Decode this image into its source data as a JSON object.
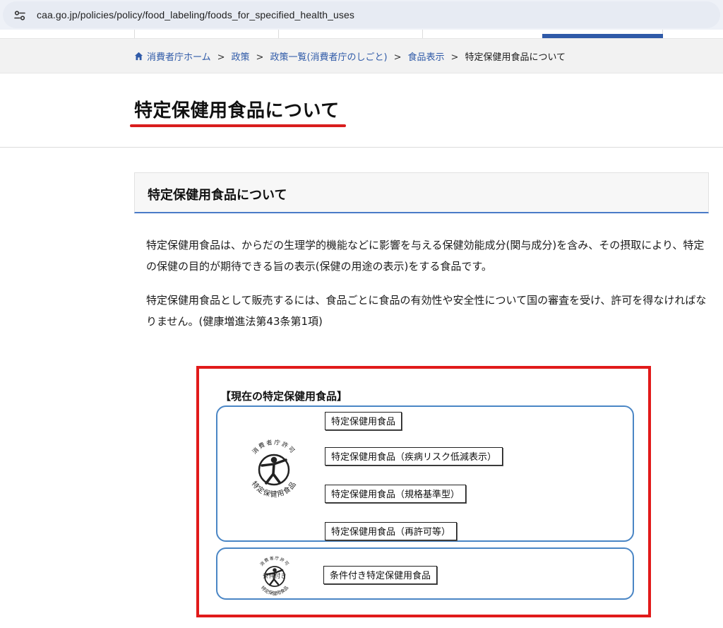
{
  "browser": {
    "url": "caa.go.jp/policies/policy/food_labeling/foods_for_specified_health_uses",
    "site_icon": "site-settings-icon"
  },
  "breadcrumb": {
    "items": [
      "消費者庁ホーム",
      "政策",
      "政策一覧(消費者庁のしごと)",
      "食品表示"
    ],
    "separator": ">",
    "current": "特定保健用食品について"
  },
  "page": {
    "title": "特定保健用食品について",
    "accent_color": "#d91d1d"
  },
  "section": {
    "heading": "特定保健用食品について",
    "paragraphs": [
      "特定保健用食品は、からだの生理学的機能などに影響を与える保健効能成分(関与成分)を含み、その摂取により、特定の保健の目的が期待できる旨の表示(保健の用途の表示)をする食品です。",
      "特定保健用食品として販売するには、食品ごとに食品の有効性や安全性について国の審査を受け、許可を得なければなりません。(健康増進法第43条第1項)"
    ]
  },
  "figure": {
    "title": "【現在の特定保健用食品】",
    "group1_labels": [
      "特定保健用食品",
      "特定保健用食品（疾病リスク低減表示）",
      "特定保健用食品（規格基準型）",
      "特定保健用食品（再許可等）"
    ],
    "group2_label": "条件付き特定保健用食品",
    "logo_big_text": {
      "top": "消費者庁許可",
      "bottom": "特定保健用食品"
    },
    "logo_small_text": {
      "top": "消費者庁許可",
      "middle": "条件付き",
      "bottom": "特定保健用食品"
    },
    "border_color": "#e11a1a",
    "group_border_color": "#4a86c5"
  }
}
